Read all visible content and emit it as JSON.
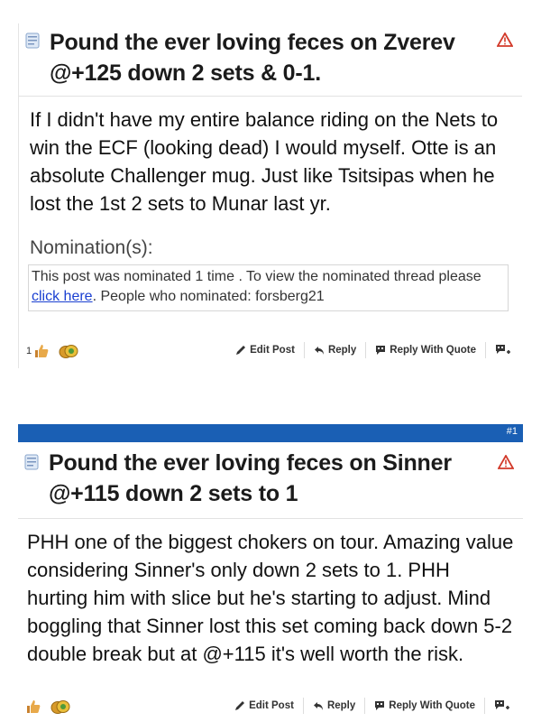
{
  "post1": {
    "title": "Pound the ever loving feces on Zverev @+125 down 2 sets & 0-1.",
    "body": "If I didn't have my entire balance riding on the Nets to win the ECF (looking dead) I would myself. Otte is an absolute Challenger mug. Just like Tsitsipas when he lost the 1st 2 sets to Munar last yr.",
    "nomination_label": "Nomination(s):",
    "nomination_text_pre": "This post was nominated 1 time . To view the nominated thread please ",
    "nomination_link": "click here",
    "nomination_text_post": ". People who nominated: forsberg21",
    "likes": "1",
    "actions": {
      "edit": "Edit Post",
      "reply": "Reply",
      "quote": "Reply With Quote"
    }
  },
  "post2": {
    "number": "#1",
    "title": "Pound the ever loving feces on Sinner @+115 down 2 sets to 1",
    "body": "PHH one of the biggest chokers on tour. Amazing value considering Sinner's only down 2 sets to 1. PHH hurting him with slice but he's starting to adjust. Mind boggling that Sinner lost this set coming back down 5-2 double break but at @+115 it's well worth the risk.",
    "actions": {
      "edit": "Edit Post",
      "reply": "Reply",
      "quote": "Reply With Quote"
    }
  },
  "colors": {
    "header_bar": "#1a5fb4",
    "link": "#1a3fd1",
    "alert": "#d23a2a"
  },
  "icons": [
    "document-icon",
    "alert-triangle-icon",
    "thumbs-up-icon",
    "coin-icon",
    "pencil-icon",
    "reply-arrow-icon",
    "quote-bubble-icon",
    "multi-quote-icon"
  ]
}
